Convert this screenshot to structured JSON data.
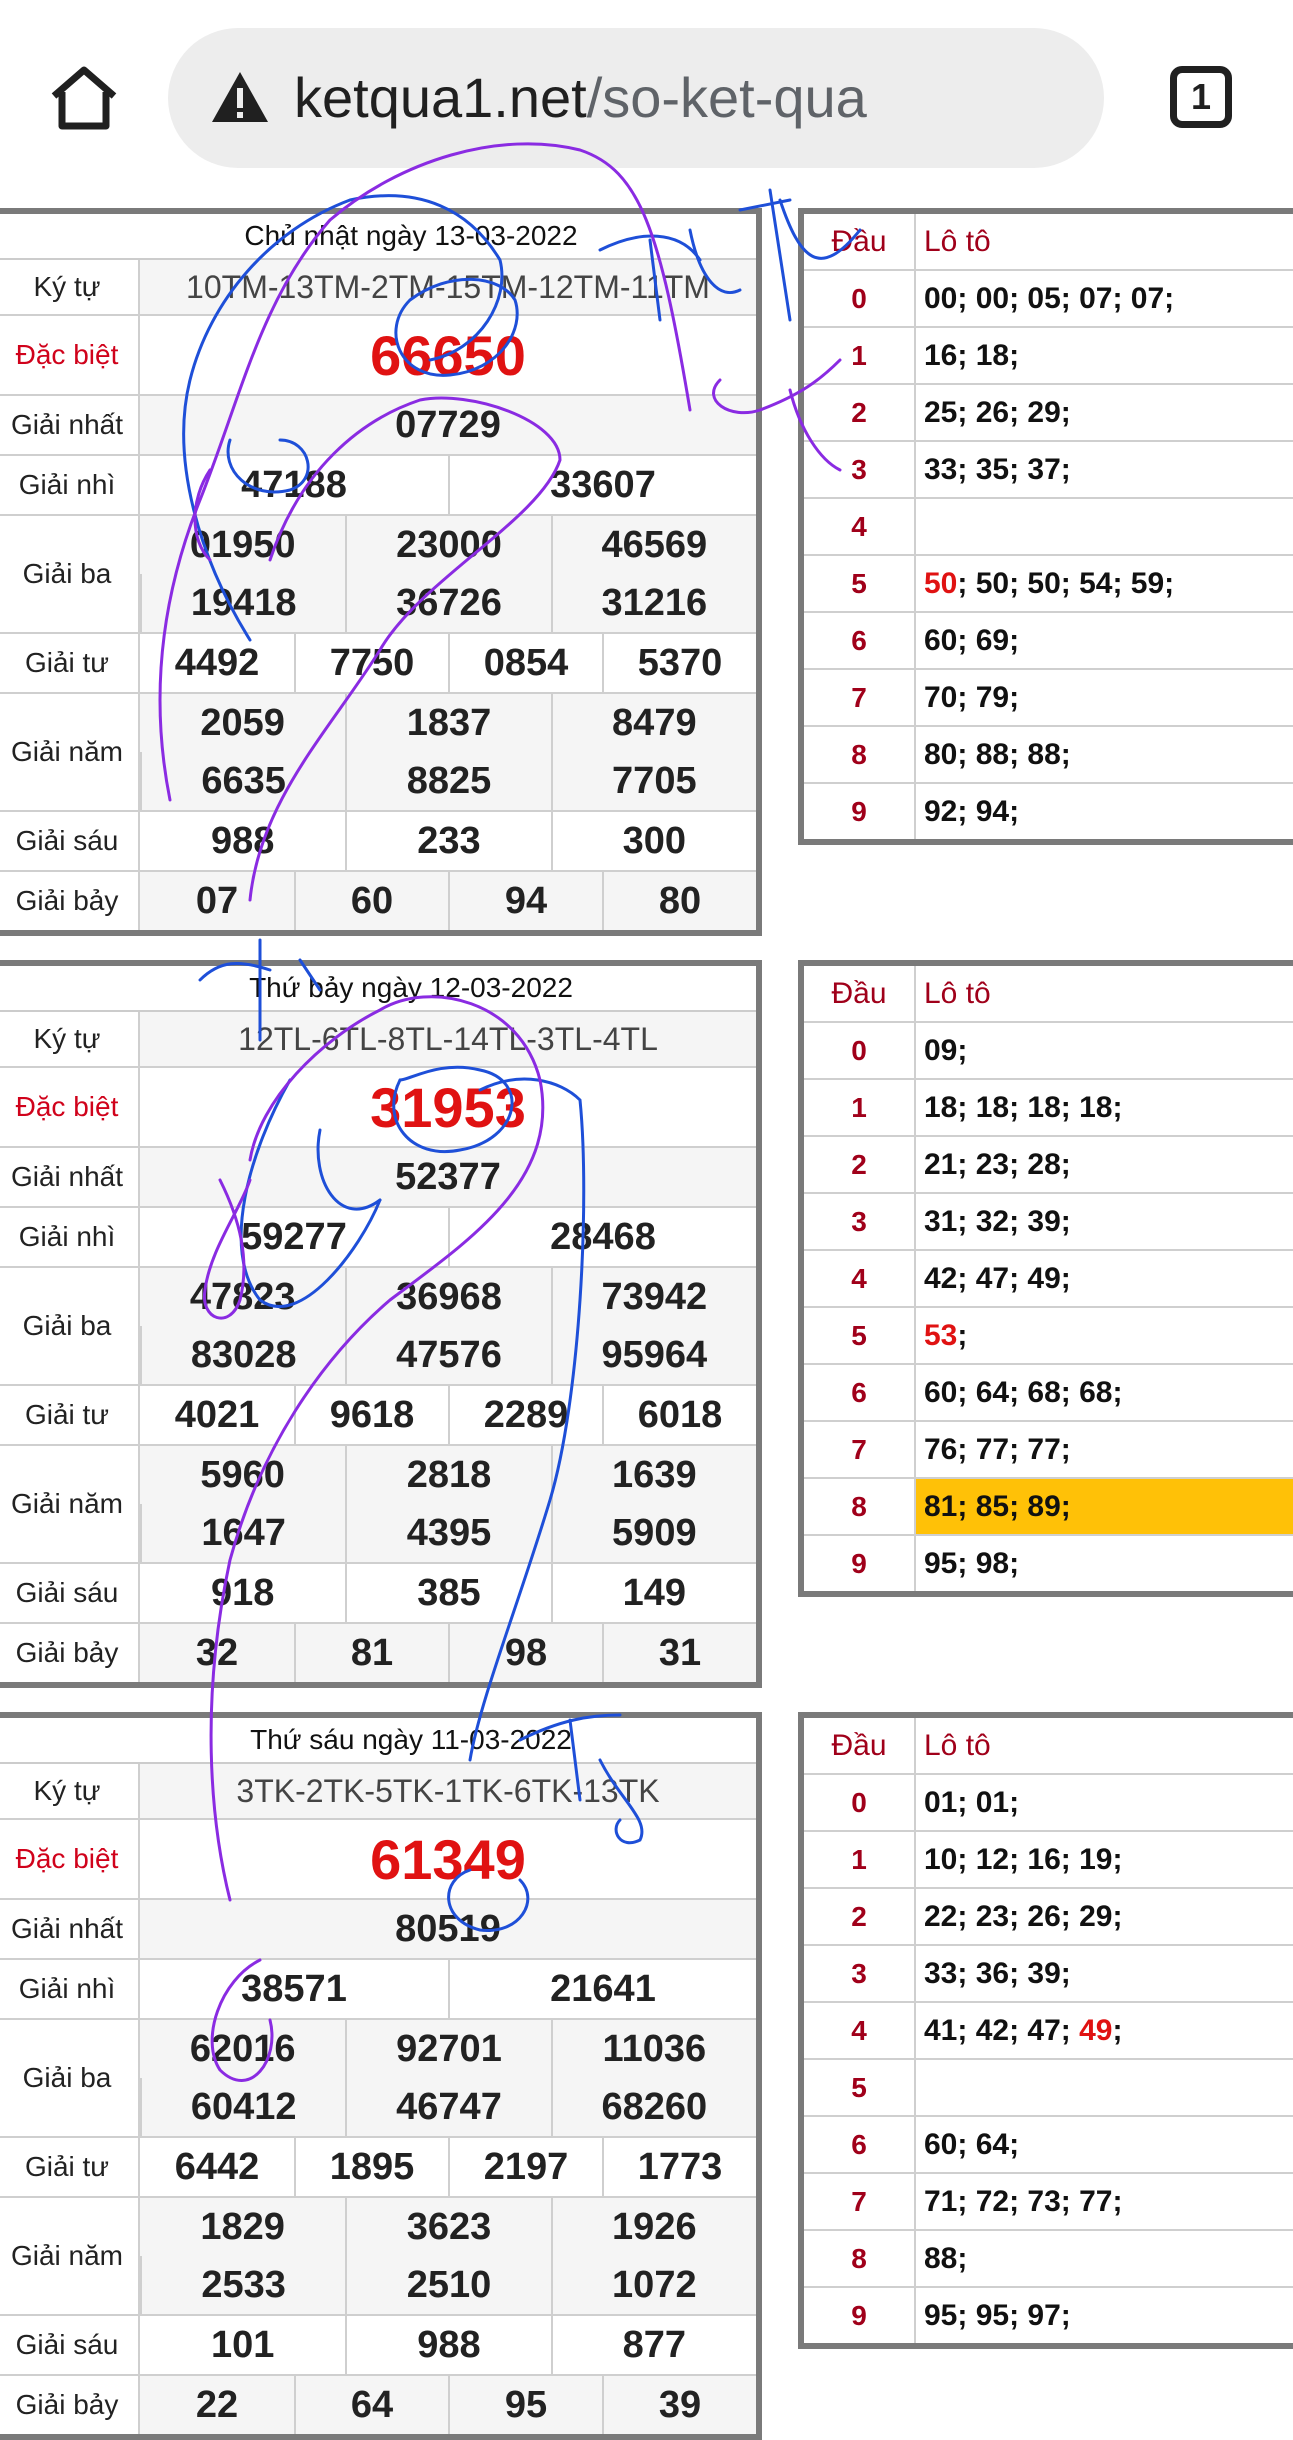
{
  "browser": {
    "url_host": "ketqua1.net",
    "url_path": "/so-ket-qua",
    "tab_count": "1"
  },
  "draws": [
    {
      "title": "Chủ nhật ngày 13-03-2022",
      "labels": {
        "code": "Ký tự",
        "special": "Đặc biệt",
        "first": "Giải nhất",
        "second": "Giải nhì",
        "third": "Giải ba",
        "fourth": "Giải tư",
        "fifth": "Giải năm",
        "sixth": "Giải sáu",
        "seventh": "Giải bảy"
      },
      "code": "10TM-13TM-2TM-15TM-12TM-11TM",
      "special": "66650",
      "first": "07729",
      "second": [
        "47188",
        "33607"
      ],
      "third": [
        "01950",
        "23000",
        "46569",
        "19418",
        "36726",
        "31216"
      ],
      "fourth": [
        "4492",
        "7750",
        "0854",
        "5370"
      ],
      "fifth": [
        "2059",
        "1837",
        "8479",
        "6635",
        "8825",
        "7705"
      ],
      "sixth": [
        "988",
        "233",
        "300"
      ],
      "seventh": [
        "07",
        "60",
        "94",
        "80"
      ],
      "loto_head": {
        "dau": "Đầu",
        "loto": "Lô tô"
      },
      "loto": [
        {
          "d": "0",
          "parts": [
            {
              "t": "00; 00; 05; 07; 07;"
            }
          ]
        },
        {
          "d": "1",
          "parts": [
            {
              "t": "16; 18;"
            }
          ]
        },
        {
          "d": "2",
          "parts": [
            {
              "t": "25; 26; 29;"
            }
          ]
        },
        {
          "d": "3",
          "parts": [
            {
              "t": "33; 35; 37;"
            }
          ]
        },
        {
          "d": "4",
          "parts": [
            {
              "t": ""
            }
          ]
        },
        {
          "d": "5",
          "parts": [
            {
              "t": "50",
              "red": true
            },
            {
              "t": "; 50; 50; 54; 59;"
            }
          ]
        },
        {
          "d": "6",
          "parts": [
            {
              "t": "60; 69;"
            }
          ]
        },
        {
          "d": "7",
          "parts": [
            {
              "t": "70; 79;"
            }
          ]
        },
        {
          "d": "8",
          "parts": [
            {
              "t": "80; 88; 88;"
            }
          ]
        },
        {
          "d": "9",
          "parts": [
            {
              "t": "92; 94;"
            }
          ]
        }
      ]
    },
    {
      "title": "Thứ bảy ngày 12-03-2022",
      "labels": {
        "code": "Ký tự",
        "special": "Đặc biệt",
        "first": "Giải nhất",
        "second": "Giải nhì",
        "third": "Giải ba",
        "fourth": "Giải tư",
        "fifth": "Giải năm",
        "sixth": "Giải sáu",
        "seventh": "Giải bảy"
      },
      "code": "12TL-6TL-8TL-14TL-3TL-4TL",
      "special": "31953",
      "first": "52377",
      "second": [
        "59277",
        "28468"
      ],
      "third": [
        "47823",
        "36968",
        "73942",
        "83028",
        "47576",
        "95964"
      ],
      "fourth": [
        "4021",
        "9618",
        "2289",
        "6018"
      ],
      "fifth": [
        "5960",
        "2818",
        "1639",
        "1647",
        "4395",
        "5909"
      ],
      "sixth": [
        "918",
        "385",
        "149"
      ],
      "seventh": [
        "32",
        "81",
        "98",
        "31"
      ],
      "loto_head": {
        "dau": "Đầu",
        "loto": "Lô tô"
      },
      "loto": [
        {
          "d": "0",
          "parts": [
            {
              "t": "09;"
            }
          ]
        },
        {
          "d": "1",
          "parts": [
            {
              "t": "18; 18; 18; 18;"
            }
          ]
        },
        {
          "d": "2",
          "parts": [
            {
              "t": "21; 23; 28;"
            }
          ]
        },
        {
          "d": "3",
          "parts": [
            {
              "t": "31; 32; 39;"
            }
          ]
        },
        {
          "d": "4",
          "parts": [
            {
              "t": "42; 47; 49;"
            }
          ]
        },
        {
          "d": "5",
          "parts": [
            {
              "t": "53",
              "red": true
            },
            {
              "t": ";"
            }
          ]
        },
        {
          "d": "6",
          "parts": [
            {
              "t": "60; 64; 68; 68;"
            }
          ]
        },
        {
          "d": "7",
          "parts": [
            {
              "t": "76; 77; 77;"
            }
          ]
        },
        {
          "d": "8",
          "parts": [
            {
              "t": "81; 85; 89;"
            }
          ],
          "highlight": true
        },
        {
          "d": "9",
          "parts": [
            {
              "t": "95; 98;"
            }
          ]
        }
      ]
    },
    {
      "title": "Thứ sáu ngày 11-03-2022",
      "labels": {
        "code": "Ký tự",
        "special": "Đặc biệt",
        "first": "Giải nhất",
        "second": "Giải nhì",
        "third": "Giải ba",
        "fourth": "Giải tư",
        "fifth": "Giải năm",
        "sixth": "Giải sáu",
        "seventh": "Giải bảy"
      },
      "code": "3TK-2TK-5TK-1TK-6TK-13TK",
      "special": "61349",
      "first": "80519",
      "second": [
        "38571",
        "21641"
      ],
      "third": [
        "62016",
        "92701",
        "11036",
        "60412",
        "46747",
        "68260"
      ],
      "fourth": [
        "6442",
        "1895",
        "2197",
        "1773"
      ],
      "fifth": [
        "1829",
        "3623",
        "1926",
        "2533",
        "2510",
        "1072"
      ],
      "sixth": [
        "101",
        "988",
        "877"
      ],
      "seventh": [
        "22",
        "64",
        "95",
        "39"
      ],
      "loto_head": {
        "dau": "Đầu",
        "loto": "Lô tô"
      },
      "loto": [
        {
          "d": "0",
          "parts": [
            {
              "t": "01; 01;"
            }
          ]
        },
        {
          "d": "1",
          "parts": [
            {
              "t": "10; 12; 16; 19;"
            }
          ]
        },
        {
          "d": "2",
          "parts": [
            {
              "t": "22; 23; 26; 29;"
            }
          ]
        },
        {
          "d": "3",
          "parts": [
            {
              "t": "33; 36; 39;"
            }
          ]
        },
        {
          "d": "4",
          "parts": [
            {
              "t": "41; 42; 47; "
            },
            {
              "t": "49",
              "red": true
            },
            {
              "t": ";"
            }
          ]
        },
        {
          "d": "5",
          "parts": [
            {
              "t": ""
            }
          ]
        },
        {
          "d": "6",
          "parts": [
            {
              "t": "60; 64;"
            }
          ]
        },
        {
          "d": "7",
          "parts": [
            {
              "t": "71; 72; 73; 77;"
            }
          ]
        },
        {
          "d": "8",
          "parts": [
            {
              "t": "88;"
            }
          ]
        },
        {
          "d": "9",
          "parts": [
            {
              "t": "95; 95; 97;"
            }
          ]
        }
      ]
    }
  ],
  "colors": {
    "special": "#e01212",
    "dau": "#a0001a",
    "highlight": "#ffc107",
    "border": "#7a7a7a"
  }
}
